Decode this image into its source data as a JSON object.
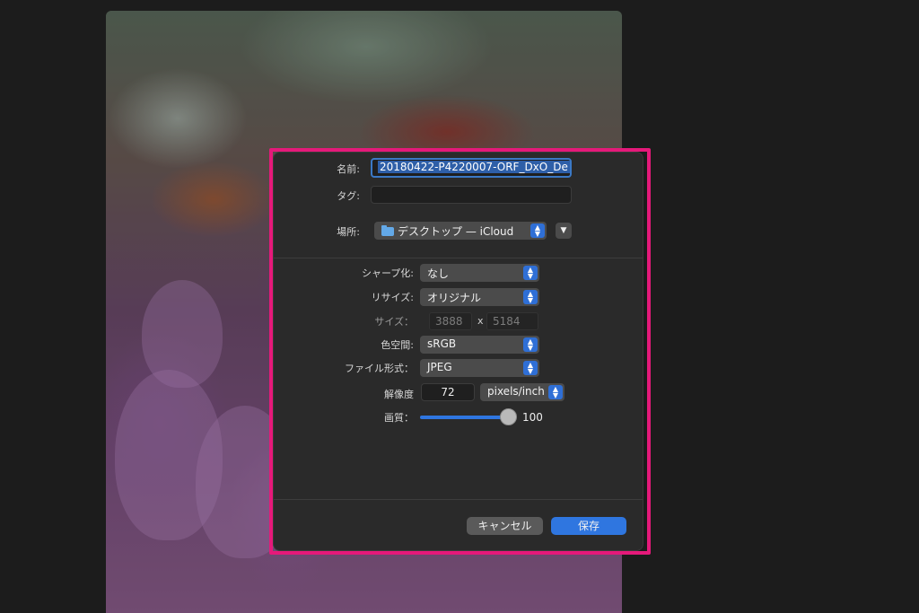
{
  "dialog": {
    "name_label": "名前:",
    "name_value": "20180422-P4220007-ORF_DxO_De",
    "tags_label": "タグ:",
    "tags_value": "",
    "location_label": "場所:",
    "location_value": "デスクトップ — iCloud",
    "sharpen_label": "シャープ化:",
    "sharpen_value": "なし",
    "resize_label": "リサイズ:",
    "resize_value": "オリジナル",
    "size_label": "サイズ：",
    "size_width": "3888",
    "size_x": "x",
    "size_height": "5184",
    "colorspace_label": "色空間:",
    "colorspace_value": "sRGB",
    "format_label": "ファイル形式：",
    "format_value": "JPEG",
    "resolution_label": "解像度",
    "resolution_value": "72",
    "resolution_unit": "pixels/inch",
    "quality_label": "画質：",
    "quality_value": "100",
    "cancel_label": "キャンセル",
    "save_label": "保存"
  },
  "colors": {
    "highlight": "#e5197a",
    "accent": "#2f76e0"
  },
  "icons": [
    "folder-icon",
    "chevron-updown-icon",
    "chevron-down-icon"
  ]
}
